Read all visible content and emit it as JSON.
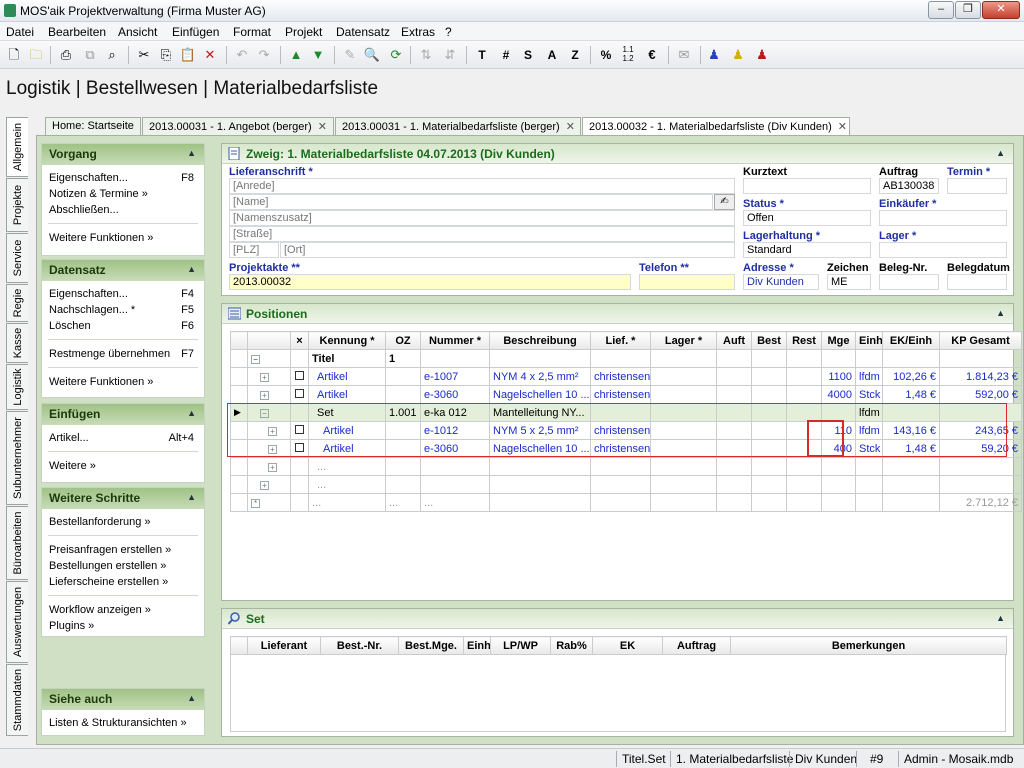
{
  "window": {
    "title": "MOS'aik Projektverwaltung (Firma Muster AG)"
  },
  "menu": [
    "Datei",
    "Bearbeiten",
    "Ansicht",
    "Einfügen",
    "Format",
    "Projekt",
    "Datensatz",
    "Extras",
    "?"
  ],
  "toolbar_text_buttons": [
    "T",
    "#",
    "S",
    "A",
    "Z",
    "%"
  ],
  "breadcrumb": "Logistik | Bestellwesen | Materialbedarfsliste",
  "vertical_tabs": [
    "Allgemein",
    "Projekte",
    "Service",
    "Regie",
    "Kasse",
    "Logistik",
    "Subunternehmer",
    "Büroarbeiten",
    "Auswertungen",
    "Stammdaten"
  ],
  "doc_tabs": [
    "Home: Startseite",
    "2013.00031 - 1. Angebot (berger)",
    "2013.00031 - 1. Materialbedarfsliste (berger)",
    "2013.00032 - 1. Materialbedarfsliste (Div Kunden)"
  ],
  "left": {
    "vorgang": {
      "title": "Vorgang",
      "items": [
        {
          "label": "Eigenschaften...",
          "key": "F8"
        },
        {
          "label": "Notizen & Termine »"
        },
        {
          "label": "Abschließen..."
        },
        {
          "label": "Weitere Funktionen »"
        }
      ]
    },
    "datensatz": {
      "title": "Datensatz",
      "items": [
        {
          "label": "Eigenschaften...",
          "key": "F4"
        },
        {
          "label": "Nachschlagen... *",
          "key": "F5"
        },
        {
          "label": "Löschen",
          "key": "F6"
        },
        {
          "label": "Restmenge übernehmen",
          "key": "F7"
        },
        {
          "label": "Weitere Funktionen »"
        }
      ]
    },
    "einfuegen": {
      "title": "Einfügen",
      "items": [
        {
          "label": "Artikel...",
          "key": "Alt+4"
        },
        {
          "label": "Weitere »"
        }
      ]
    },
    "schritte": {
      "title": "Weitere Schritte",
      "items": [
        {
          "label": "Bestellanforderung »"
        },
        {
          "label": "Preisanfragen erstellen »"
        },
        {
          "label": "Bestellungen erstellen »"
        },
        {
          "label": "Lieferscheine erstellen »"
        },
        {
          "label": "Workflow anzeigen »"
        },
        {
          "label": "Plugins »"
        }
      ]
    },
    "sieheauch": {
      "title": "Siehe auch",
      "items": [
        {
          "label": "Listen & Strukturansichten »"
        }
      ]
    }
  },
  "zweig": {
    "title": "Zweig: 1. Materialbedarfsliste 04.07.2013 (Div Kunden)",
    "lieferanschrift_label": "Lieferanschrift *",
    "anrede": "[Anrede]",
    "name": "[Name]",
    "namenszusatz": "[Namenszusatz]",
    "strasse": "[Straße]",
    "plz": "[PLZ]",
    "ort": "[Ort]",
    "projektakte_label": "Projektakte **",
    "projektakte": "2013.00032",
    "telefon_label": "Telefon **",
    "telefon": "",
    "kurztext_label": "Kurztext",
    "kurztext": "",
    "status_label": "Status *",
    "status": "Offen",
    "lagerhaltung_label": "Lagerhaltung *",
    "lagerhaltung": "Standard",
    "adresse_label": "Adresse *",
    "adresse": "Div Kunden",
    "zeichen_label": "Zeichen",
    "zeichen": "ME",
    "auftrag_label": "Auftrag",
    "auftrag": "AB130038",
    "termin_label": "Termin *",
    "termin": "",
    "einkaeufer_label": "Einkäufer *",
    "einkaeufer": "",
    "lager_label": "Lager *",
    "lager": "",
    "belegnr_label": "Beleg-Nr.",
    "belegnr": "",
    "belegdatum_label": "Belegdatum",
    "belegdatum": ""
  },
  "positionen": {
    "title": "Positionen",
    "columns": [
      "",
      "",
      "×",
      "Kennung *",
      "OZ",
      "Nummer *",
      "Beschreibung",
      "Lief. *",
      "Lager *",
      "Auft",
      "Best",
      "Rest",
      "Mge",
      "Einh",
      "EK/Einh",
      "KP Gesamt"
    ],
    "rows": [
      {
        "kennung": "Titel",
        "oz": "1",
        "nummer": "",
        "beschreibung": "",
        "lief": "",
        "mge": "",
        "einh": "",
        "ek": "",
        "kp": ""
      },
      {
        "kennung": "Artikel",
        "oz": "",
        "nummer": "e-1007",
        "beschreibung": "NYM 4 x 2,5 mm²",
        "lief": "christensen",
        "mge": "1100",
        "einh": "lfdm",
        "ek": "102,26 €",
        "kp": "1.814,23 €"
      },
      {
        "kennung": "Artikel",
        "oz": "",
        "nummer": "e-3060",
        "beschreibung": "Nagelschellen 10 ...",
        "lief": "christensen",
        "mge": "4000",
        "einh": "Stck",
        "ek": "1,48 €",
        "kp": "592,00 €"
      },
      {
        "kennung": "Set",
        "oz": "1.001",
        "nummer": "e-ka 012",
        "beschreibung": "Mantelleitung NY...",
        "lief": "",
        "mge": "",
        "einh": "lfdm",
        "ek": "",
        "kp": ""
      },
      {
        "kennung": "Artikel",
        "oz": "",
        "nummer": "e-1012",
        "beschreibung": "NYM 5 x 2,5 mm²",
        "lief": "christensen",
        "mge": "110",
        "einh": "lfdm",
        "ek": "143,16 €",
        "kp": "243,65 €"
      },
      {
        "kennung": "Artikel",
        "oz": "",
        "nummer": "e-3060",
        "beschreibung": "Nagelschellen 10 ...",
        "lief": "christensen",
        "mge": "400",
        "einh": "Stck",
        "ek": "1,48 €",
        "kp": "59,20 €"
      }
    ],
    "ellipsis": "...",
    "total": "2.712,12 €"
  },
  "set": {
    "title": "Set",
    "columns": [
      "Lieferant",
      "Best.-Nr.",
      "Best.Mge.",
      "Einh",
      "LP/WP",
      "Rab%",
      "EK",
      "Auftrag",
      "Bemerkungen"
    ]
  },
  "status": [
    "Titel.Set",
    "1. Materialbedarfsliste",
    "Div Kunden",
    "#9",
    "Admin - Mosaik.mdb"
  ]
}
